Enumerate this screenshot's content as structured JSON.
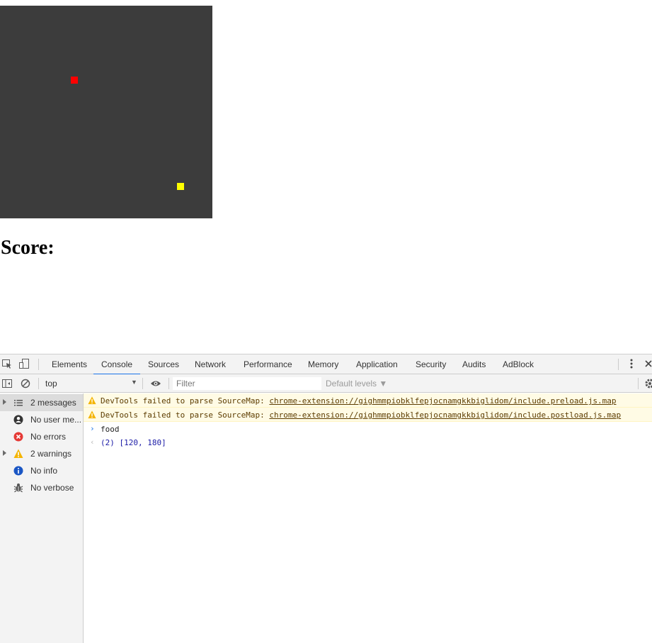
{
  "game": {
    "score_label": "Score:",
    "snake_color": "#ff0000",
    "food_color": "#ffff00",
    "board_color": "#3c3c3c"
  },
  "devtools": {
    "tabs": [
      "Elements",
      "Console",
      "Sources",
      "Network",
      "Performance",
      "Memory",
      "Application",
      "Security",
      "Audits",
      "AdBlock"
    ],
    "active_tab": "Console",
    "context": "top",
    "filter_placeholder": "Filter",
    "levels": "Default levels ▼",
    "sidebar": [
      {
        "label": "2 messages",
        "icon": "list-icon"
      },
      {
        "label": "No user me...",
        "icon": "user-icon"
      },
      {
        "label": "No errors",
        "icon": "error-icon"
      },
      {
        "label": "2 warnings",
        "icon": "warning-icon"
      },
      {
        "label": "No info",
        "icon": "info-icon"
      },
      {
        "label": "No verbose",
        "icon": "bug-icon"
      }
    ],
    "messages": [
      {
        "type": "warning",
        "text": "DevTools failed to parse SourceMap: ",
        "link": "chrome-extension://gighmmpiobklfepjocnamgkkbiglidom/include.preload.js.map"
      },
      {
        "type": "warning",
        "text": "DevTools failed to parse SourceMap: ",
        "link": "chrome-extension://gighmmpiobklfepjocnamgkkbiglidom/include.postload.js.map"
      },
      {
        "type": "input",
        "text": "food"
      },
      {
        "type": "result",
        "text": "(2) [120, 180]"
      }
    ],
    "colors": {
      "accent": "#1a73e8",
      "warning_bg": "#fffbe5",
      "warning_icon": "#f4b400",
      "error": "#e53935",
      "info": "#1a56c4"
    }
  }
}
